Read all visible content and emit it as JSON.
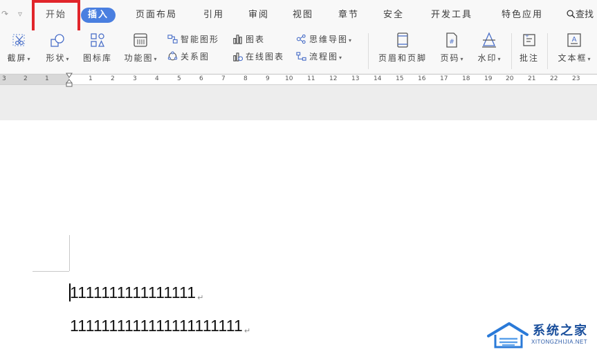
{
  "menu": {
    "tabs": [
      {
        "label": "开始"
      },
      {
        "label": "插入"
      },
      {
        "label": "页面布局"
      },
      {
        "label": "引用"
      },
      {
        "label": "审阅"
      },
      {
        "label": "视图"
      },
      {
        "label": "章节"
      },
      {
        "label": "安全"
      },
      {
        "label": "开发工具"
      },
      {
        "label": "特色应用"
      }
    ],
    "search_label": "查找",
    "active_tab": "插入",
    "highlighted_tab": "开始",
    "accent_color": "#4a7fe0",
    "highlight_color": "#e1252b"
  },
  "ribbon": {
    "screenshot": "截屏",
    "shapes": "形状",
    "icon_library": "图标库",
    "function_chart": "功能图",
    "smart_graphic": "智能图形",
    "chart": "图表",
    "mind_map": "思维导图",
    "relation_chart": "关系图",
    "online_chart": "在线图表",
    "flow_chart": "流程图",
    "header_footer": "页眉和页脚",
    "page_number": "页码",
    "watermark": "水印",
    "comment": "批注",
    "text_box": "文本框"
  },
  "ruler": {
    "left_numbers": [
      "3",
      "2",
      "1"
    ],
    "right_numbers": [
      "1",
      "2",
      "3",
      "4",
      "5",
      "6",
      "7",
      "8",
      "9",
      "10",
      "11",
      "12",
      "13",
      "14",
      "15",
      "16",
      "17",
      "18",
      "19",
      "20",
      "21",
      "22",
      "23"
    ]
  },
  "document": {
    "line1": "1111111111111111",
    "line2": "1111111111111111111111",
    "para_mark": "↵"
  },
  "watermark": {
    "name": "系统之家",
    "url": "XITONGZHIJIA.NET"
  }
}
